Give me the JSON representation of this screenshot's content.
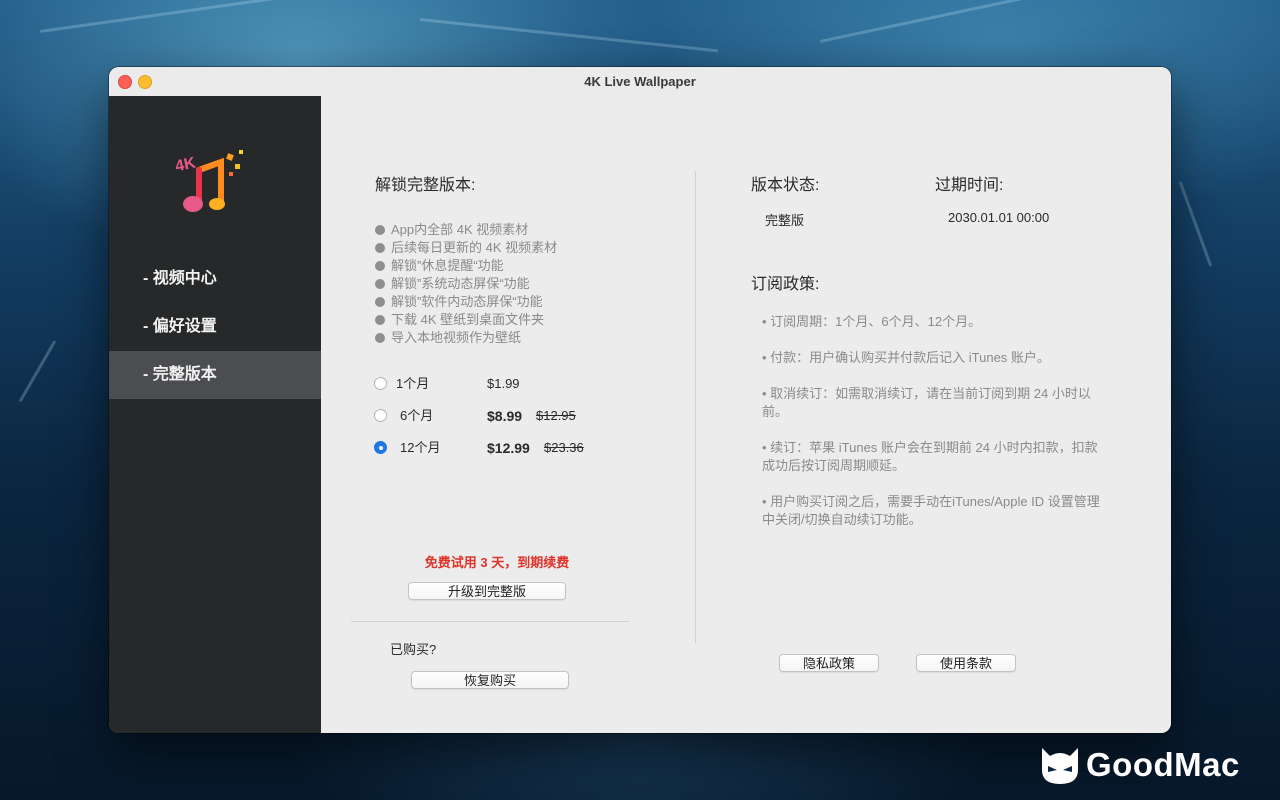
{
  "window": {
    "title": "4K Live Wallpaper"
  },
  "sidebar": {
    "items": [
      {
        "label": "- 视频中心"
      },
      {
        "label": "- 偏好设置"
      },
      {
        "label": "- 完整版本"
      }
    ],
    "active_index": 2
  },
  "unlock": {
    "heading": "解锁完整版本:",
    "features": [
      "App内全部 4K 视频素材",
      "后续每日更新的 4K 视频素材",
      "解锁”休息提醒“功能",
      "解锁”系统动态屏保“功能",
      "解锁”软件内动态屏保“功能",
      "下载 4K 壁纸到桌面文件夹",
      "导入本地视频作为壁纸"
    ],
    "plans": [
      {
        "name": "1个月",
        "price": "$1.99",
        "original": "",
        "selected": false
      },
      {
        "name": "6个月",
        "price": "$8.99",
        "original": "$12.95",
        "selected": false
      },
      {
        "name": "12个月",
        "price": "$12.99",
        "original": "$23.36",
        "selected": true
      }
    ],
    "trial_notice": "免费试用 3 天，到期续费",
    "upgrade_button": "升级到完整版",
    "purchased_question": "已购买?",
    "restore_button": "恢复购买"
  },
  "status": {
    "version_label": "版本状态:",
    "expiry_label": "过期时间:",
    "version_value": "完整版",
    "expiry_value": "2030.01.01 00:00"
  },
  "policy": {
    "heading": "订阅政策:",
    "items": [
      "• 订阅周期：1个月、6个月、12个月。",
      "• 付款：用户确认购买并付款后记入 iTunes 账户。",
      "• 取消续订：如需取消续订，请在当前订阅到期 24 小时以前。",
      "• 续订：苹果 iTunes 账户会在到期前 24 小时内扣款，扣款成功后按订阅周期顺延。",
      "• 用户购买订阅之后，需要手动在iTunes/Apple ID 设置管理中关闭/切换自动续订功能。"
    ],
    "privacy_button": "隐私政策",
    "terms_button": "使用条款"
  },
  "watermark": {
    "text": "GoodMac"
  },
  "colors": {
    "accent": "#1f78e6",
    "trial_red": "#e0342a",
    "sidebar_bg": "#262829",
    "sidebar_active": "#4b4d50"
  }
}
